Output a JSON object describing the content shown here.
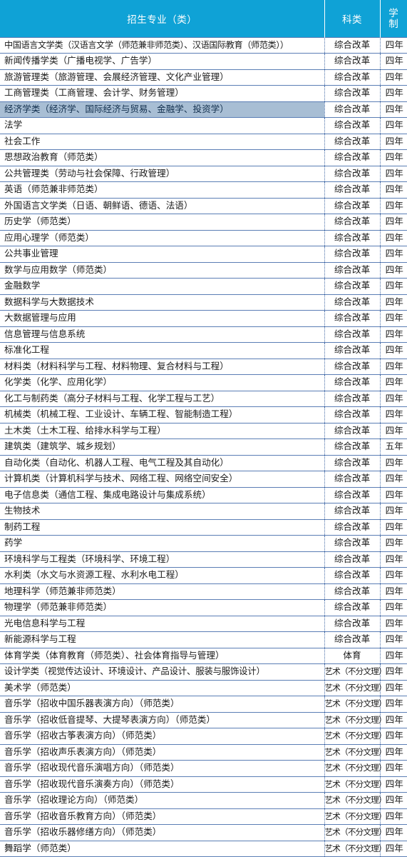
{
  "table": {
    "headers": {
      "major": "招生专业（类）",
      "category": "科类",
      "years_char1": "学",
      "years_char2": "制"
    },
    "colors": {
      "header_bg": "#0FA2D6",
      "header_text": "#FFFFFF",
      "row_border": "#5B7EB5",
      "selected_row_bg": "#A8BED4",
      "body_text": "#1A1A1A"
    },
    "selected_row_index": 4,
    "rows": [
      {
        "major": "中国语言文学类（汉语言文学（师范兼非师范类）、汉语国际教育（师范类））",
        "category": "综合改革",
        "years": "四年"
      },
      {
        "major": "新闻传播学类（广播电视学、广告学）",
        "category": "综合改革",
        "years": "四年"
      },
      {
        "major": "旅游管理类（旅游管理、会展经济管理、文化产业管理）",
        "category": "综合改革",
        "years": "四年"
      },
      {
        "major": "工商管理类（工商管理、会计学、财务管理）",
        "category": "综合改革",
        "years": "四年"
      },
      {
        "major": "经济学类（经济学、国际经济与贸易、金融学、投资学）",
        "category": "综合改革",
        "years": "四年"
      },
      {
        "major": "法学",
        "category": "综合改革",
        "years": "四年"
      },
      {
        "major": "社会工作",
        "category": "综合改革",
        "years": "四年"
      },
      {
        "major": "思想政治教育（师范类）",
        "category": "综合改革",
        "years": "四年"
      },
      {
        "major": "公共管理类（劳动与社会保障、行政管理）",
        "category": "综合改革",
        "years": "四年"
      },
      {
        "major": "英语（师范兼非师范类）",
        "category": "综合改革",
        "years": "四年"
      },
      {
        "major": "外国语言文学类（日语、朝鲜语、德语、法语）",
        "category": "综合改革",
        "years": "四年"
      },
      {
        "major": "历史学（师范类）",
        "category": "综合改革",
        "years": "四年"
      },
      {
        "major": "应用心理学（师范类）",
        "category": "综合改革",
        "years": "四年"
      },
      {
        "major": "公共事业管理",
        "category": "综合改革",
        "years": "四年"
      },
      {
        "major": "数学与应用数学（师范类）",
        "category": "综合改革",
        "years": "四年"
      },
      {
        "major": "金融数学",
        "category": "综合改革",
        "years": "四年"
      },
      {
        "major": "数据科学与大数据技术",
        "category": "综合改革",
        "years": "四年"
      },
      {
        "major": "大数据管理与应用",
        "category": "综合改革",
        "years": "四年"
      },
      {
        "major": "信息管理与信息系统",
        "category": "综合改革",
        "years": "四年"
      },
      {
        "major": "标准化工程",
        "category": "综合改革",
        "years": "四年"
      },
      {
        "major": "材料类（材料科学与工程、材料物理、复合材料与工程）",
        "category": "综合改革",
        "years": "四年"
      },
      {
        "major": "化学类（化学、应用化学）",
        "category": "综合改革",
        "years": "四年"
      },
      {
        "major": "化工与制药类（高分子材料与工程、化学工程与工艺）",
        "category": "综合改革",
        "years": "四年"
      },
      {
        "major": "机械类（机械工程、工业设计、车辆工程、智能制造工程）",
        "category": "综合改革",
        "years": "四年"
      },
      {
        "major": "土木类（土木工程、给排水科学与工程）",
        "category": "综合改革",
        "years": "四年"
      },
      {
        "major": "建筑类（建筑学、城乡规划）",
        "category": "综合改革",
        "years": "五年"
      },
      {
        "major": "自动化类（自动化、机器人工程、电气工程及其自动化）",
        "category": "综合改革",
        "years": "四年"
      },
      {
        "major": "计算机类（计算机科学与技术、网络工程、网络空间安全）",
        "category": "综合改革",
        "years": "四年"
      },
      {
        "major": "电子信息类（通信工程、集成电路设计与集成系统）",
        "category": "综合改革",
        "years": "四年"
      },
      {
        "major": "生物技术",
        "category": "综合改革",
        "years": "四年"
      },
      {
        "major": "制药工程",
        "category": "综合改革",
        "years": "四年"
      },
      {
        "major": "药学",
        "category": "综合改革",
        "years": "四年"
      },
      {
        "major": "环境科学与工程类（环境科学、环境工程）",
        "category": "综合改革",
        "years": "四年"
      },
      {
        "major": "水利类（水文与水资源工程、水利水电工程）",
        "category": "综合改革",
        "years": "四年"
      },
      {
        "major": "地理科学（师范兼非师范类）",
        "category": "综合改革",
        "years": "四年"
      },
      {
        "major": "物理学（师范兼非师范类）",
        "category": "综合改革",
        "years": "四年"
      },
      {
        "major": "光电信息科学与工程",
        "category": "综合改革",
        "years": "四年"
      },
      {
        "major": "新能源科学与工程",
        "category": "综合改革",
        "years": "四年"
      },
      {
        "major": "体育学类（体育教育（师范类）、社会体育指导与管理）",
        "category": "体育",
        "years": "四年"
      },
      {
        "major": "设计学类（视觉传达设计、环境设计、产品设计、服装与服饰设计）",
        "category": "艺术（不分文理）",
        "years": "四年"
      },
      {
        "major": "美术学（师范类）",
        "category": "艺术（不分文理）",
        "years": "四年"
      },
      {
        "major": "音乐学（招收中国乐器表演方向）（师范类）",
        "category": "艺术（不分文理）",
        "years": "四年"
      },
      {
        "major": "音乐学（招收低音提琴、大提琴表演方向）（师范类）",
        "category": "艺术（不分文理）",
        "years": "四年"
      },
      {
        "major": "音乐学（招收古筝表演方向）（师范类）",
        "category": "艺术（不分文理）",
        "years": "四年"
      },
      {
        "major": "音乐学（招收声乐表演方向）（师范类）",
        "category": "艺术（不分文理）",
        "years": "四年"
      },
      {
        "major": "音乐学（招收现代音乐演唱方向）（师范类）",
        "category": "艺术（不分文理）",
        "years": "四年"
      },
      {
        "major": "音乐学（招收现代音乐演奏方向）（师范类）",
        "category": "艺术（不分文理）",
        "years": "四年"
      },
      {
        "major": "音乐学（招收理论方向）（师范类）",
        "category": "艺术（不分文理）",
        "years": "四年"
      },
      {
        "major": "音乐学（招收音乐教育方向）（师范类）",
        "category": "艺术（不分文理）",
        "years": "四年"
      },
      {
        "major": "音乐学（招收乐器修缮方向）（师范类）",
        "category": "艺术（不分文理）",
        "years": "四年"
      },
      {
        "major": "舞蹈学（师范类）",
        "category": "艺术（不分文理）",
        "years": "四年"
      }
    ]
  }
}
